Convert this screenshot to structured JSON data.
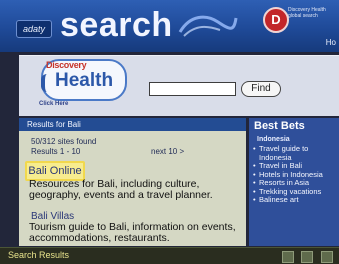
{
  "header": {
    "logo_badge": "adaty",
    "title": "search",
    "red_logo_letter": "D",
    "tagline": "Discovery Health global search",
    "right_label": "Ho"
  },
  "search_panel": {
    "logo_top": "Discovery",
    "logo_bottom": "Health",
    "find_label": "Find",
    "input_value": "",
    "click_here": "Click Here"
  },
  "results": {
    "bar_label": "Results for Bali",
    "count_line1": "50/312 sites found",
    "count_line2": "Results 1 - 10",
    "next_label": "next 10 >",
    "items": [
      {
        "title": "Bali Online",
        "desc": "Resources for Bali, including culture, geography, events and a travel planner."
      },
      {
        "title": "Bali Villas",
        "desc": "Tourism guide to Bali, information on events, accommodations, restaurants."
      }
    ]
  },
  "best_bets": {
    "title": "Best Bets",
    "sub": "Indonesia",
    "items": [
      "Travel guide to Indonesia",
      "Travel in Bali",
      "Hotels in Indonesia",
      "Resorts in Asia",
      "Trekking vacations",
      "Balinese art"
    ]
  },
  "status": {
    "text": "Search Results"
  },
  "colors": {
    "header_blue": "#2e5fb4",
    "result_highlight": "#f7ec8f",
    "best_bets_blue": "#2f4f9a"
  }
}
